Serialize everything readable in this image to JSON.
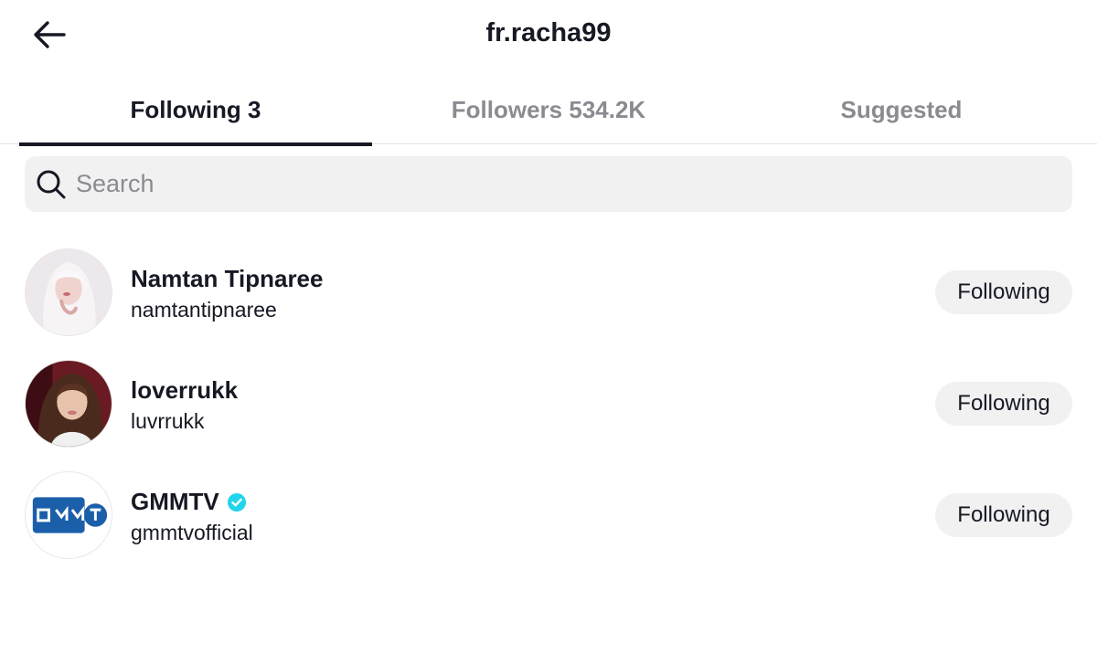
{
  "header": {
    "title": "fr.racha99",
    "back_icon": "arrow-left-icon"
  },
  "tabs": [
    {
      "label": "Following 3",
      "active": true
    },
    {
      "label": "Followers 534.2K",
      "active": false
    },
    {
      "label": "Suggested",
      "active": false
    }
  ],
  "search": {
    "placeholder": "Search",
    "value": "",
    "icon": "search-icon"
  },
  "users": [
    {
      "display_name": "Namtan Tipnaree",
      "username": "namtantipnaree",
      "verified": false,
      "button_label": "Following"
    },
    {
      "display_name": "loverrukk",
      "username": "luvrrukk",
      "verified": false,
      "button_label": "Following"
    },
    {
      "display_name": "GMMTV",
      "username": "gmmtvofficial",
      "verified": true,
      "button_label": "Following"
    }
  ],
  "colors": {
    "text_primary": "#161823",
    "text_secondary": "#8a8b91",
    "button_bg": "#f1f1f2",
    "verified": "#20d5ec"
  }
}
